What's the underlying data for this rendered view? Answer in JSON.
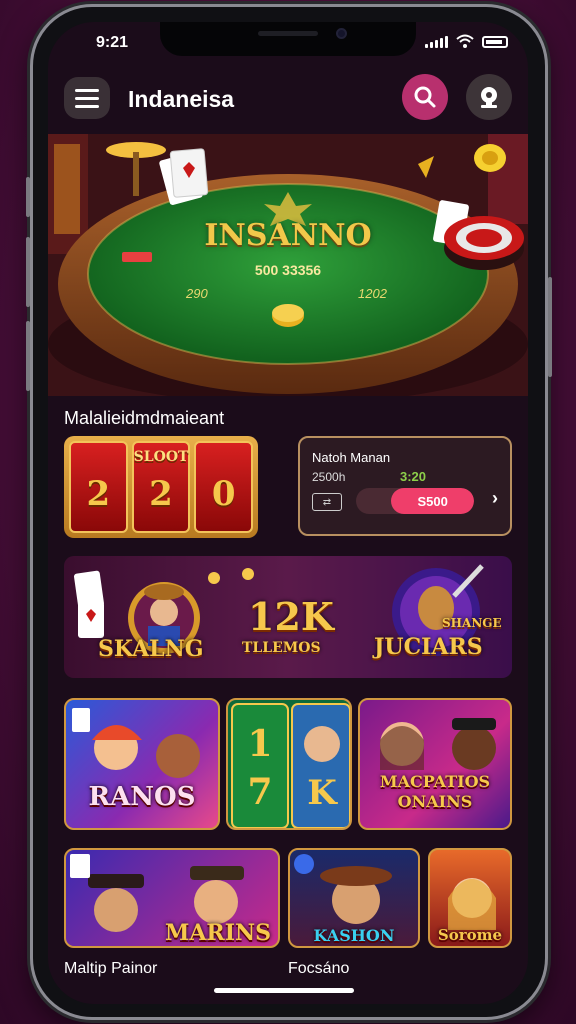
{
  "status": {
    "time": "9:21"
  },
  "app": {
    "title": "Indaneisa"
  },
  "hero": {
    "title": "INSANNO",
    "subtitle": "500 33356",
    "left_number": "290",
    "right_number": "1202"
  },
  "section": {
    "title": "Malalieidmdmaieant"
  },
  "slot_card": {
    "label": "SLOOT",
    "reels": [
      "2",
      "2",
      "0"
    ]
  },
  "match_card": {
    "title": "Natoh Manan",
    "odds_left": "2500h",
    "odds_right": "3:20",
    "bar_value": "S500",
    "bar_fill_fraction": 0.7
  },
  "banner": {
    "items": [
      "SKALNG",
      "12K",
      "TLLEMOS",
      "JUCIARS",
      "SHANGE"
    ]
  },
  "tiles_row1": [
    "RANOS",
    "MACPATIOS ONAINS"
  ],
  "tiles_row2": [
    "MARINS",
    "KASHON",
    "Sorome"
  ],
  "bottom": {
    "left_label": "Maltip Painor",
    "right_label": "Focsáno"
  },
  "colors": {
    "accent": "#b8306e",
    "gold": "#f6c84c",
    "background": "#1b0c1a"
  },
  "icons": [
    "menu-icon",
    "search-icon",
    "settings-icon",
    "signal-icon",
    "wifi-icon",
    "battery-icon",
    "chevron-right-icon"
  ]
}
